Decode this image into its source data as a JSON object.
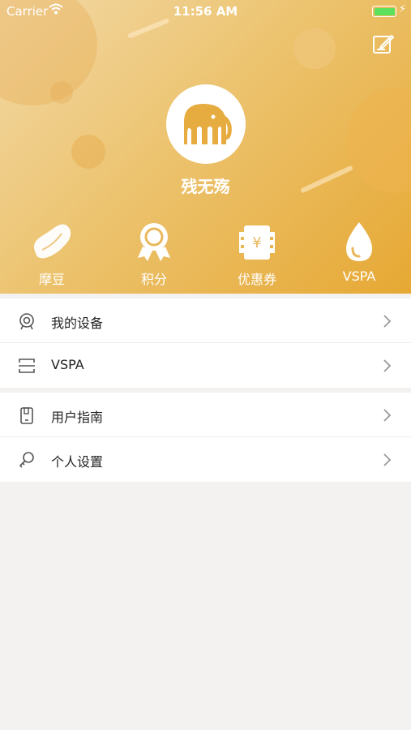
{
  "status_bar": {
    "carrier": "Carrier",
    "time": "11:56 AM"
  },
  "profile": {
    "username": "残无殇"
  },
  "quick_actions": [
    {
      "label": "摩豆",
      "icon": "bean-icon"
    },
    {
      "label": "积分",
      "icon": "medal-icon"
    },
    {
      "label": "优惠券",
      "icon": "coupon-icon"
    },
    {
      "label": "VSPA",
      "icon": "drop-icon"
    }
  ],
  "menu_group_1": [
    {
      "label": "我的设备",
      "icon": "device-icon"
    },
    {
      "label": "VSPA",
      "icon": "scan-icon"
    }
  ],
  "menu_group_2": [
    {
      "label": "用户指南",
      "icon": "guide-icon"
    },
    {
      "label": "个人设置",
      "icon": "settings-icon"
    }
  ],
  "colors": {
    "accent": "#e8b24a",
    "background": "#f3f2f0"
  }
}
